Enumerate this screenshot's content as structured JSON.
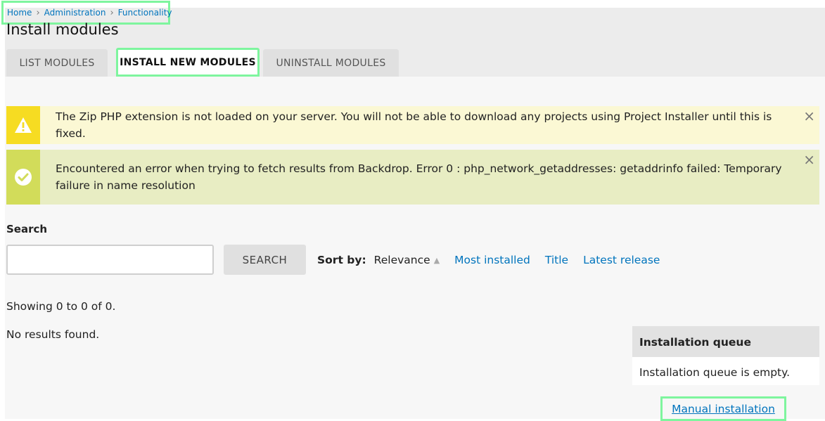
{
  "breadcrumb": {
    "items": [
      "Home",
      "Administration",
      "Functionality"
    ]
  },
  "page": {
    "title": "Install modules"
  },
  "tabs": [
    {
      "label": "LIST MODULES"
    },
    {
      "label": "INSTALL NEW MODULES"
    },
    {
      "label": "UNINSTALL MODULES"
    }
  ],
  "messages": {
    "warning": {
      "text": "The Zip PHP extension is not loaded on your server. You will not be able to download any projects using Project Installer until this is fixed.",
      "icon": "warning-icon",
      "close": "×"
    },
    "status": {
      "text": "Encountered an error when trying to fetch results from Backdrop. Error 0 : php_network_getaddresses: getaddrinfo failed: Temporary failure in name resolution",
      "icon": "check-circle-icon",
      "close": "×"
    }
  },
  "search": {
    "label": "Search",
    "value": "",
    "button": "SEARCH"
  },
  "sort": {
    "label": "Sort by:",
    "active": "Relevance",
    "options": [
      "Most installed",
      "Title",
      "Latest release"
    ]
  },
  "results": {
    "showing": "Showing 0 to 0 of 0.",
    "empty": "No results found."
  },
  "queue": {
    "title": "Installation queue",
    "empty": "Installation queue is empty."
  },
  "manual_link": "Manual installation",
  "colors": {
    "link": "#0074bd",
    "highlight": "#7ef59e",
    "warning": "#f6dc22",
    "status": "#d2dc5a"
  }
}
